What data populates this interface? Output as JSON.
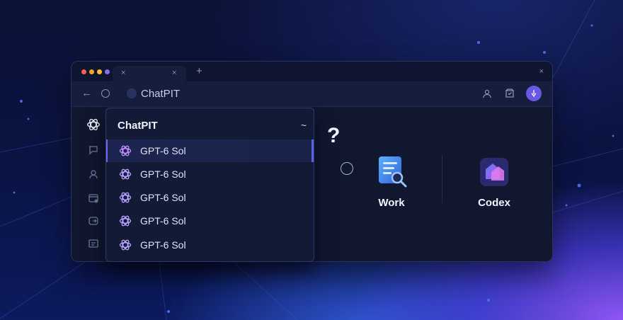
{
  "window": {
    "tab": {
      "close_glyph": "×"
    },
    "new_tab_glyph": "+",
    "close_glyph": "×",
    "traffic_lights": [
      "#ff5f57",
      "#f5a524",
      "#ffbd2e",
      "#8e6cf0"
    ]
  },
  "address_bar": {
    "back_glyph": "←",
    "url": "ChatPIT",
    "icons": [
      "user-icon",
      "save-icon",
      "mic-icon"
    ]
  },
  "sidebar": {
    "icons": [
      "openai-logo-icon",
      "chat-icon",
      "profile-icon",
      "window-icon",
      "exit-icon",
      "notes-icon"
    ]
  },
  "main": {
    "question_glyph": "?",
    "cards": [
      {
        "label": "Work",
        "icon": "document-search-icon"
      },
      {
        "label": "Codex",
        "icon": "codex-cube-icon"
      }
    ]
  },
  "dropdown": {
    "title": "ChatPIT",
    "chevron_glyph": "~",
    "selected_index": 0,
    "items": [
      {
        "label": "GPT-6 Sol"
      },
      {
        "label": "GPT-6 Sol"
      },
      {
        "label": "GPT-6 Sol"
      },
      {
        "label": "GPT-6 Sol"
      },
      {
        "label": "GPT-6 Sol"
      }
    ]
  },
  "colors": {
    "accent": "#6b57e6",
    "panel": "#121a36",
    "window": "#111834"
  }
}
